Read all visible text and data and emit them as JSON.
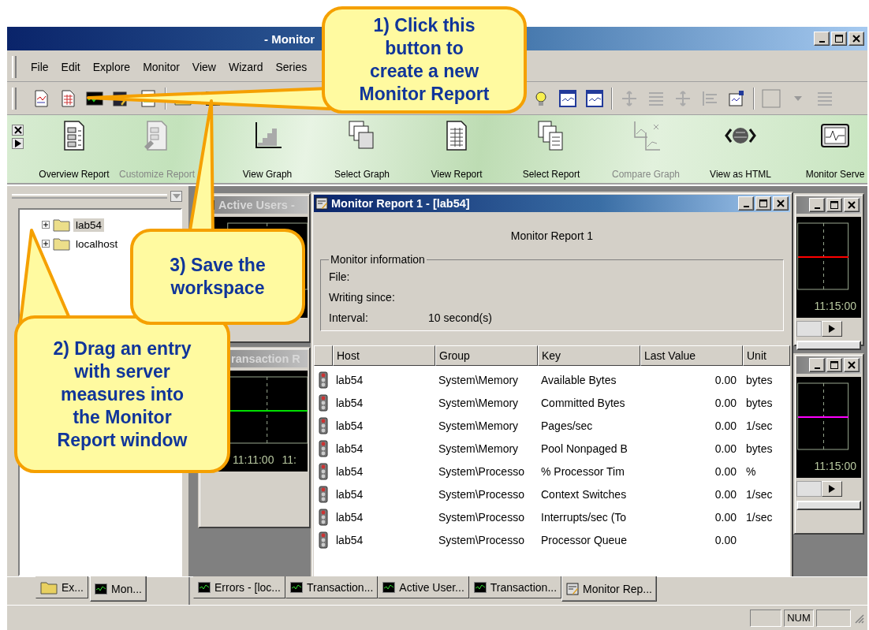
{
  "window": {
    "title": "- Monitor"
  },
  "menu": [
    "File",
    "Edit",
    "Explore",
    "Monitor",
    "View",
    "Wizard",
    "Series"
  ],
  "action_bar": [
    {
      "label": "Overview Report",
      "disabled": false
    },
    {
      "label": "Customize Report",
      "disabled": true
    },
    {
      "label": "View Graph",
      "disabled": false
    },
    {
      "label": "Select Graph",
      "disabled": false
    },
    {
      "label": "View Report",
      "disabled": false
    },
    {
      "label": "Select Report",
      "disabled": false
    },
    {
      "label": "Compare Graph",
      "disabled": true
    },
    {
      "label": "View as HTML",
      "disabled": false
    },
    {
      "label": "Monitor Serve",
      "disabled": false
    }
  ],
  "tree": [
    {
      "label": "lab54",
      "expanded": false,
      "selected": true
    },
    {
      "label": "localhost",
      "expanded": false,
      "selected": false
    }
  ],
  "graph_windows": [
    {
      "title": "Active Users -"
    },
    {
      "title": "ransaction R",
      "color": "#00e000",
      "time_labels": [
        "11:11:00",
        "11:"
      ]
    },
    {
      "color": "#ff0000",
      "time_labels": [
        "11:15:00"
      ]
    },
    {
      "color": "#ff00ff",
      "time_labels": [
        "11:15:00"
      ]
    }
  ],
  "report": {
    "title": "Monitor Report 1 - [lab54]",
    "heading": "Monitor Report 1",
    "group_label": "Monitor information",
    "fields": [
      {
        "label": "File:"
      },
      {
        "label": "Writing since:"
      },
      {
        "label": "Interval:",
        "value": "10 second(s)"
      }
    ],
    "columns": [
      "Host",
      "Group",
      "Key",
      "Last Value",
      "Unit"
    ],
    "rows": [
      {
        "host": "lab54",
        "group": "System\\Memory",
        "key": "Available Bytes",
        "last_value": "0.00",
        "unit": "bytes"
      },
      {
        "host": "lab54",
        "group": "System\\Memory",
        "key": "Committed Bytes",
        "last_value": "0.00",
        "unit": "bytes"
      },
      {
        "host": "lab54",
        "group": "System\\Memory",
        "key": "Pages/sec",
        "last_value": "0.00",
        "unit": "1/sec"
      },
      {
        "host": "lab54",
        "group": "System\\Memory",
        "key": "Pool Nonpaged B",
        "last_value": "0.00",
        "unit": "bytes"
      },
      {
        "host": "lab54",
        "group": "System\\Processo",
        "key": "% Processor Tim",
        "last_value": "0.00",
        "unit": "%"
      },
      {
        "host": "lab54",
        "group": "System\\Processo",
        "key": "Context Switches",
        "last_value": "0.00",
        "unit": "1/sec"
      },
      {
        "host": "lab54",
        "group": "System\\Processo",
        "key": "Interrupts/sec (To",
        "last_value": "0.00",
        "unit": "1/sec"
      },
      {
        "host": "lab54",
        "group": "System\\Processo",
        "key": "Processor Queue",
        "last_value": "0.00"
      }
    ]
  },
  "left_tabs": [
    {
      "label": "Ex...",
      "selected": false
    },
    {
      "label": "Mon...",
      "selected": true
    }
  ],
  "mdi_tabs": [
    {
      "label": "Errors - [loc...",
      "selected": false
    },
    {
      "label": "Transaction...",
      "selected": false
    },
    {
      "label": "Active User...",
      "selected": false
    },
    {
      "label": "Transaction...",
      "selected": false
    },
    {
      "label": "Monitor Rep...",
      "selected": true
    }
  ],
  "status_bar": {
    "indicator": "NUM"
  },
  "callouts": [
    {
      "text": "1) Click this\nbutton to\ncreate a new\nMonitor Report"
    },
    {
      "text": "2) Drag an entry\nwith server\nmeasures into\nthe Monitor\nReport window"
    },
    {
      "text": "3) Save the\nworkspace"
    }
  ]
}
